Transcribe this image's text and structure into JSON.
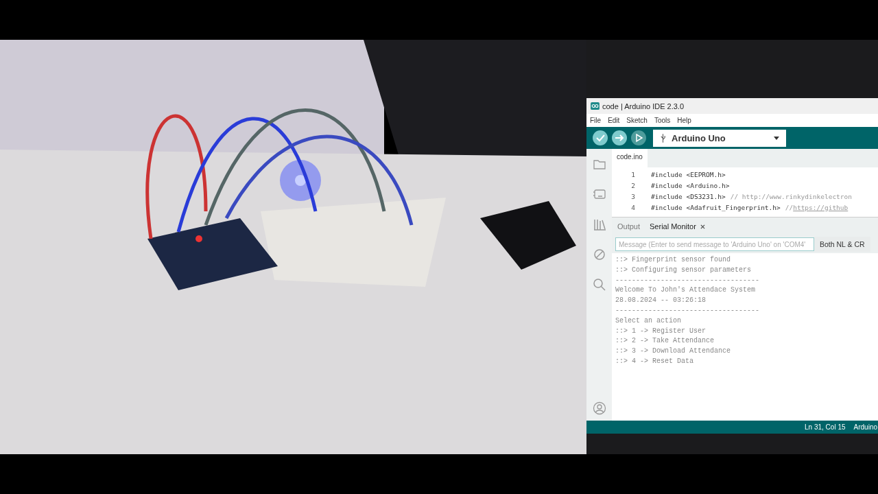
{
  "photo": {
    "kind": "picture"
  },
  "window": {
    "title": "code | Arduino IDE 2.3.0"
  },
  "menu": [
    "File",
    "Edit",
    "Sketch",
    "Tools",
    "Help"
  ],
  "toolbar": {
    "buttons": [
      {
        "kind": "verify",
        "disabled": false
      },
      {
        "kind": "upload",
        "disabled": false
      },
      {
        "kind": "debug",
        "disabled": true
      }
    ],
    "board": "Arduino Uno"
  },
  "sidebar": [
    {
      "kind": "folder",
      "selected": false
    },
    {
      "kind": "board",
      "selected": false
    },
    {
      "kind": "library",
      "selected": false
    },
    {
      "kind": "debug",
      "selected": false
    },
    {
      "kind": "search",
      "selected": false
    },
    {
      "kind": "account",
      "selected": false
    }
  ],
  "editor": {
    "tabs": [
      {
        "label": "code.ino",
        "selected": true
      }
    ],
    "lines": [
      {
        "number": "1",
        "code": "#include <EEPROM.h>"
      },
      {
        "number": "2",
        "code": "#include <Arduino.h>"
      },
      {
        "number": "3",
        "code": "#include <DS3231.h>",
        "comment": "// http://www.rinkydinkelectron"
      },
      {
        "number": "4",
        "code": "#include <Adafruit_Fingerprint.h>",
        "comment": "// ",
        "link": "https://github"
      }
    ]
  },
  "panel": {
    "tabs": [
      {
        "label": "Output",
        "selected": false
      },
      {
        "label": "Serial Monitor",
        "selected": true
      }
    ],
    "message": {
      "placeholder": "Message (Enter to send message to 'Arduino Uno' on 'COM4'"
    },
    "line_ending": "Both NL & CR",
    "output": [
      "::> Fingerprint sensor found",
      "::> Configuring sensor parameters",
      "-----------------------------------",
      "Welcome To John's Attendace System",
      "28.08.2024 -- 03:26:18",
      "-----------------------------------",
      "Select an action",
      "::> 1 -> Register User",
      "::> 2 -> Take Attendance",
      "::> 3 -> Download Attendance",
      "::> 4 -> Reset Data"
    ]
  },
  "status_bar": {
    "position": "Ln 31, Col 15",
    "board": "Arduino"
  }
}
